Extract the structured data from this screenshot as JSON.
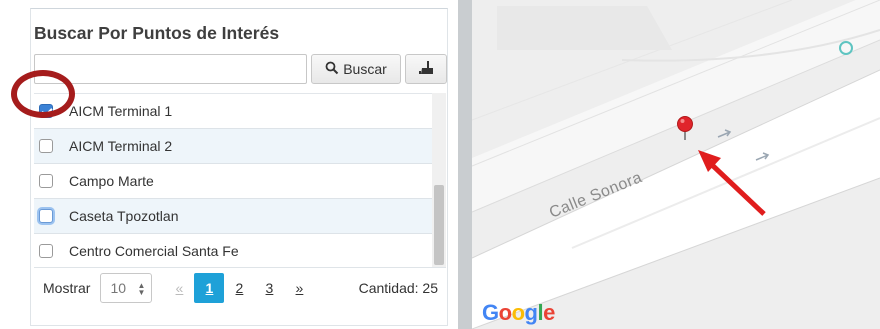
{
  "panel": {
    "title": "Buscar Por Puntos de Interés",
    "search_value": "",
    "search_placeholder": "",
    "search_button_label": "Buscar"
  },
  "poi_list": [
    {
      "label": "AICM Terminal 1",
      "checked": true
    },
    {
      "label": "AICM Terminal 2",
      "checked": false
    },
    {
      "label": "Campo Marte",
      "checked": false
    },
    {
      "label": "Caseta Tpozotlan",
      "checked": false
    },
    {
      "label": "Centro Comercial Santa Fe",
      "checked": false
    }
  ],
  "footer": {
    "show_label": "Mostrar",
    "page_size": "10",
    "prev": "«",
    "pages": [
      "1",
      "2",
      "3"
    ],
    "active_page": "1",
    "next": "»",
    "count_label": "Cantidad: 25"
  },
  "map": {
    "street_name": "Calle Sonora",
    "attribution": [
      "G",
      "o",
      "o",
      "g",
      "l",
      "e"
    ],
    "marker_color": "#e0242b",
    "arrow_color": "#e01d1d"
  },
  "colors": {
    "accent": "#1ea1d8",
    "annotation_ring": "#a51c1c"
  }
}
